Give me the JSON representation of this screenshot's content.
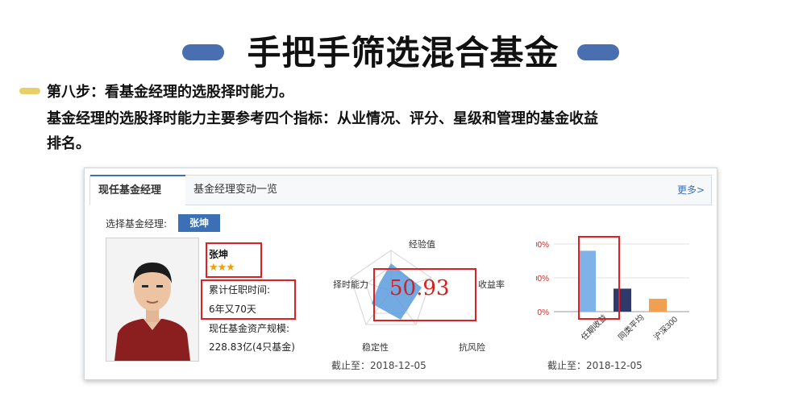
{
  "slide": {
    "title": "手把手筛选混合基金",
    "step_heading": "第八步：看基金经理的选股择时能力。",
    "body_line1": "基金经理的选股择时能力主要参考四个指标：从业情况、评分、星级和管理的基金收益",
    "body_line2": "排名。"
  },
  "screenshot": {
    "tabs": [
      "现任基金经理",
      "基金经理变动一览"
    ],
    "more_link": "更多>",
    "select_label": "选择基金经理:",
    "selected_manager": "张坤",
    "manager": {
      "name": "张坤",
      "stars": "★★★",
      "tenure_label": "累计任职时间:",
      "tenure_value": "6年又70天",
      "assets_label": "现任基金资产规模:",
      "assets_value": "228.83亿(4只基金)"
    },
    "radar": {
      "score": "50.93",
      "axes": [
        "经验值",
        "收益率",
        "抗风险",
        "稳定性",
        "择时能力"
      ],
      "deadline": "截止至：2018-12-05"
    },
    "returns_chart_deadline": "截止至：2018-12-05"
  },
  "chart_data": {
    "type": "bar",
    "categories": [
      "任期收益",
      "同类平均",
      "沪深300"
    ],
    "values": [
      180,
      68,
      38
    ],
    "colors": [
      "#7fb3e8",
      "#2f3a6b",
      "#f0a050"
    ],
    "yticks": [
      "0%",
      "100%",
      "200%"
    ],
    "ylim": [
      0,
      200
    ]
  }
}
